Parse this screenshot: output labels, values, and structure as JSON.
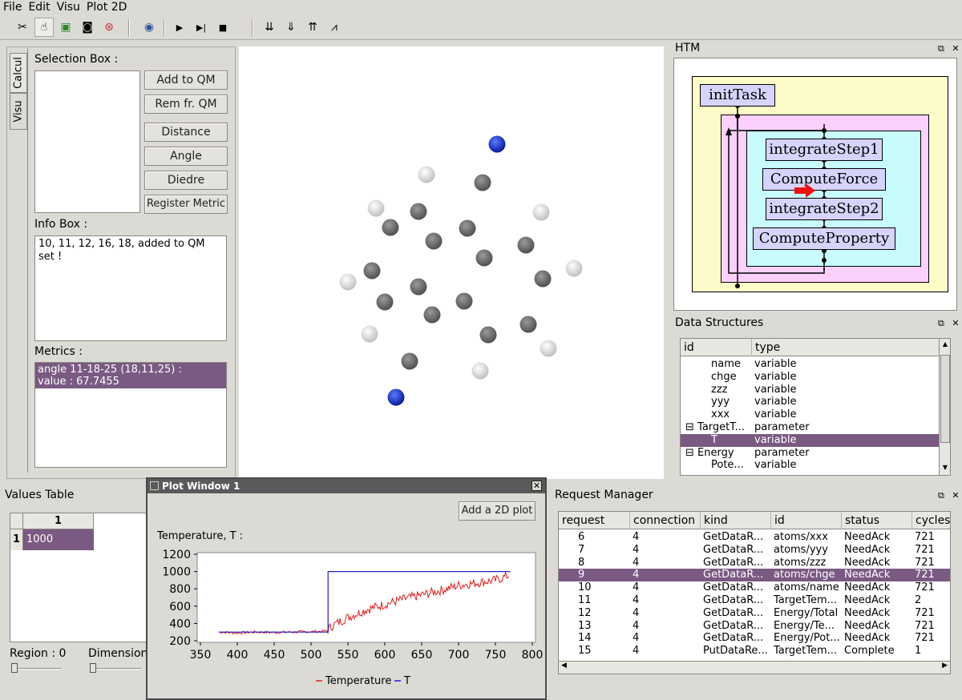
{
  "menu": [
    "File",
    "Edit",
    "Visu",
    "Plot 2D"
  ],
  "toolbar": {
    "icons": [
      "scissors-icon",
      "hand-pointer-icon",
      "film-icon",
      "camera-icon",
      "lifebuoy-icon",
      "eye-icon",
      "play-icon",
      "step-play-icon",
      "stop-icon",
      "down-arrows-icon",
      "down-arrows-double-icon",
      "up-arrows-icon",
      "chart-icon"
    ]
  },
  "left_panel": {
    "tabs": [
      "Calcul",
      "Visu"
    ],
    "selection_box_label": "Selection Box :",
    "buttons": [
      "Add to QM",
      "Rem fr. QM",
      "Distance",
      "Angle",
      "Diedre",
      "Register Metric"
    ],
    "info_box_label": "Info Box :",
    "info_box_text": "10, 11, 12, 16, 18,  added to QM set !",
    "metrics_label": "Metrics :",
    "metrics_line1": "angle 11-18-25 (18,11,25) :",
    "metrics_line2": "value : 67.7455"
  },
  "htm_panel": {
    "title": "HTM",
    "nodes": [
      "initTask",
      "integrateStep1",
      "ComputeForce",
      "integrateStep2",
      "ComputeProperty"
    ],
    "dock_icons": "⧉ ✕",
    "highlight_color": "#ee1111"
  },
  "data_structures": {
    "title": "Data Structures",
    "columns": [
      "id",
      "type"
    ],
    "rows": [
      {
        "id": "name",
        "type": "variable",
        "prefix": "",
        "indent": 2
      },
      {
        "id": "chge",
        "type": "variable",
        "prefix": "",
        "indent": 2
      },
      {
        "id": "zzz",
        "type": "variable",
        "prefix": "",
        "indent": 2
      },
      {
        "id": "yyy",
        "type": "variable",
        "prefix": "",
        "indent": 2
      },
      {
        "id": "xxx",
        "type": "variable",
        "prefix": "",
        "indent": 2
      },
      {
        "id": "TargetT...",
        "type": "parameter",
        "prefix": "⊟",
        "indent": 1
      },
      {
        "id": "T",
        "type": "variable",
        "prefix": "",
        "indent": 2
      },
      {
        "id": "Energy",
        "type": "parameter",
        "prefix": "⊟",
        "indent": 1
      },
      {
        "id": "Pote...",
        "type": "variable",
        "prefix": "",
        "indent": 2
      }
    ],
    "selected_index": 6
  },
  "values_table": {
    "title": "Values Table",
    "col_header": "1",
    "row_header": "1",
    "value": "1000",
    "region_label": "Region : 0",
    "dimension_label": "Dimension"
  },
  "plot_window": {
    "title": "Plot Window 1",
    "add_button": "Add a 2D plot",
    "subtitle": "Temperature, T :",
    "legend_temperature": "Temperature",
    "legend_t": "T",
    "temperature_color": "#e02020",
    "t_color": "#2020d0"
  },
  "chart_data": {
    "type": "line",
    "title": "Temperature, T :",
    "xlabel": "",
    "ylabel": "",
    "xlim": [
      350,
      800
    ],
    "ylim": [
      200,
      1200
    ],
    "x_ticks": [
      350,
      400,
      450,
      500,
      550,
      600,
      650,
      700,
      750,
      800
    ],
    "y_ticks": [
      200,
      400,
      600,
      800,
      1000,
      1200
    ],
    "legend_position": "bottom",
    "series": [
      {
        "name": "Temperature",
        "x": [
          375,
          400,
          425,
          450,
          475,
          500,
          520,
          530,
          550,
          575,
          600,
          625,
          650,
          675,
          700,
          725,
          750,
          770
        ],
        "y": [
          300,
          290,
          300,
          295,
          300,
          305,
          310,
          380,
          470,
          560,
          620,
          680,
          730,
          780,
          840,
          870,
          900,
          960
        ]
      },
      {
        "name": "T",
        "x": [
          375,
          523,
          523,
          770
        ],
        "y": [
          300,
          300,
          1000,
          1000
        ]
      }
    ]
  },
  "request_manager": {
    "title": "Request Manager",
    "columns": [
      "request",
      "connection",
      "kind",
      "id",
      "status",
      "cycles"
    ],
    "rows": [
      [
        "6",
        "4",
        "GetDataR...",
        "atoms/xxx",
        "NeedAck",
        "721"
      ],
      [
        "7",
        "4",
        "GetDataR...",
        "atoms/yyy",
        "NeedAck",
        "721"
      ],
      [
        "8",
        "4",
        "GetDataR...",
        "atoms/zzz",
        "NeedAck",
        "721"
      ],
      [
        "9",
        "4",
        "GetDataR...",
        "atoms/chge",
        "NeedAck",
        "721"
      ],
      [
        "10",
        "4",
        "GetDataR...",
        "atoms/name",
        "NeedAck",
        "721"
      ],
      [
        "11",
        "4",
        "GetDataR...",
        "TargetTem...",
        "NeedAck",
        "2"
      ],
      [
        "12",
        "4",
        "GetDataR...",
        "Energy/Total",
        "NeedAck",
        "721"
      ],
      [
        "13",
        "4",
        "GetDataR...",
        "Energy/Te...",
        "NeedAck",
        "721"
      ],
      [
        "14",
        "4",
        "GetDataR...",
        "Energy/Pot...",
        "NeedAck",
        "721"
      ],
      [
        "15",
        "4",
        "PutDataRe...",
        "TargetTem...",
        "Complete",
        "1"
      ]
    ],
    "selected_index": 3
  },
  "colors": {
    "selection": "#7a5a82",
    "atom_dark": "#6a6a6a",
    "atom_light": "#e8e8e8",
    "atom_blue": "#1a3ad8"
  }
}
